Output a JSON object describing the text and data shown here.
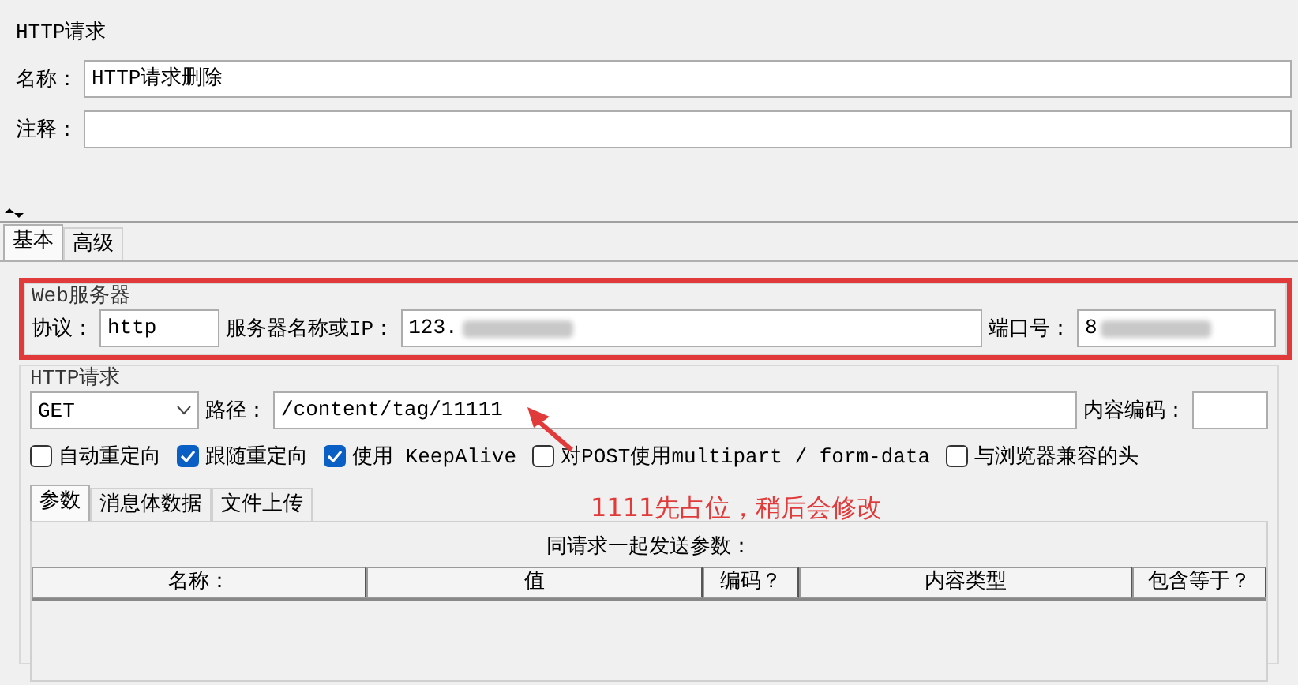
{
  "window": {
    "title": "HTTP请求"
  },
  "name_field": {
    "label": "名称：",
    "value": "HTTP请求删除"
  },
  "comment_field": {
    "label": "注释："
  },
  "tabs": [
    {
      "label": "基本",
      "selected": true
    },
    {
      "label": "高级",
      "selected": false
    }
  ],
  "web_server": {
    "title": "Web服务器",
    "highlighted": true,
    "protocol": {
      "label": "协议：",
      "value": "http"
    },
    "server": {
      "label": "服务器名称或IP：",
      "value": "123.",
      "redacted": true
    },
    "port": {
      "label": "端口号：",
      "value": "8",
      "redacted": true
    }
  },
  "http_request": {
    "title": "HTTP请求",
    "method": "GET",
    "path": {
      "label": "路径：",
      "value": "/content/tag/11111"
    },
    "encoding": {
      "label": "内容编码："
    },
    "options": [
      {
        "label": "自动重定向",
        "checked": false
      },
      {
        "label": "跟随重定向",
        "checked": true
      },
      {
        "label": "使用 KeepAlive",
        "checked": true
      },
      {
        "label": "对POST使用multipart / form-data",
        "checked": false
      },
      {
        "label": "与浏览器兼容的头",
        "checked": false
      }
    ]
  },
  "body_tabs": [
    {
      "label": "参数",
      "selected": true
    },
    {
      "label": "消息体数据",
      "selected": false
    },
    {
      "label": "文件上传",
      "selected": false
    }
  ],
  "params": {
    "caption": "同请求一起发送参数：",
    "columns": [
      "名称：",
      "值",
      "编码？",
      "内容类型",
      "包含等于？"
    ]
  },
  "annotation": {
    "text": "1111先占位，稍后会修改"
  }
}
